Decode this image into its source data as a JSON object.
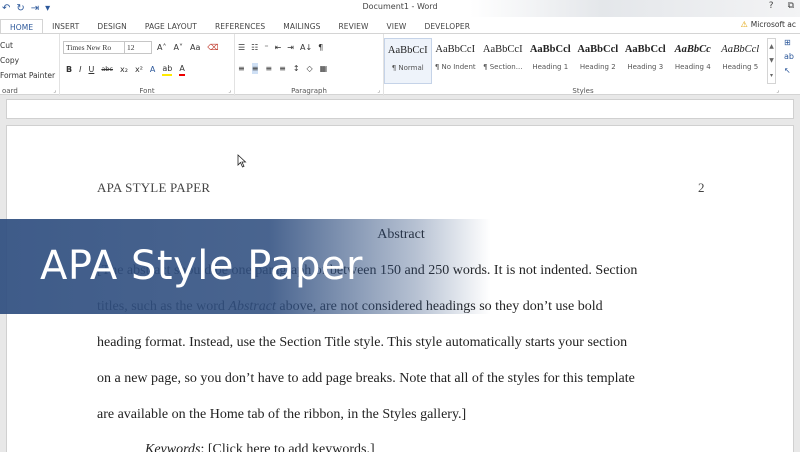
{
  "window": {
    "title": "Document1 - Word",
    "controls": [
      "?",
      "⧉"
    ]
  },
  "qat": {
    "undo": "↶",
    "redo": "↻",
    "touch": "⇥",
    "customize": "▾"
  },
  "tabs": [
    {
      "label": "HOME"
    },
    {
      "label": "INSERT"
    },
    {
      "label": "DESIGN"
    },
    {
      "label": "PAGE LAYOUT"
    },
    {
      "label": "REFERENCES"
    },
    {
      "label": "MAILINGS"
    },
    {
      "label": "REVIEW"
    },
    {
      "label": "VIEW"
    },
    {
      "label": "DEVELOPER"
    }
  ],
  "account": "Microsoft ac",
  "clipboard": {
    "items": [
      "Cut",
      "Copy",
      "Format Painter"
    ],
    "label": "oard"
  },
  "font": {
    "family": "Times New Ro",
    "size": "12",
    "grow": "A˄",
    "shrink": "A˅",
    "case": "Aa",
    "clear": "⌫",
    "bold": "B",
    "italic": "I",
    "underline": "U",
    "strike": "abc",
    "subscript": "x₂",
    "superscript": "x²",
    "effects": "A",
    "highlight": "ab",
    "color": "A",
    "label": "Font"
  },
  "paragraph": {
    "bullets": "☰",
    "numbering": "☷",
    "multilevel": "⁼",
    "decrease": "⇤",
    "increase": "⇥",
    "sort": "A↓",
    "pilcrow": "¶",
    "align_left": "≡",
    "center": "≡",
    "align_right": "≡",
    "justify": "≡",
    "spacing": "↕",
    "shading": "◇",
    "borders": "▦",
    "label": "Paragraph"
  },
  "styles": {
    "items": [
      {
        "preview": "AaBbCcI",
        "name": "¶ Normal"
      },
      {
        "preview": "AaBbCcI",
        "name": "¶ No Indent"
      },
      {
        "preview": "AaBbCcI",
        "name": "¶ Section..."
      },
      {
        "preview": "AaBbCcl",
        "name": "Heading 1"
      },
      {
        "preview": "AaBbCcl",
        "name": "Heading 2"
      },
      {
        "preview": "AaBbCcl",
        "name": "Heading 3"
      },
      {
        "preview": "AaBbCc",
        "name": "Heading 4"
      },
      {
        "preview": "AaBbCcl",
        "name": "Heading 5"
      }
    ],
    "label": "Styles"
  },
  "editing": {
    "find": "⊞",
    "replace": "ab",
    "select": "↖"
  },
  "document": {
    "running_head": "APA STYLE PAPER",
    "page_number": "2",
    "abstract_title": "Abstract",
    "lines": [
      "[The abstract should be one paragraph of between 150 and 250 words. It is not indented. Section",
      "titles, such as the word Abstract above, are not considered headings so they don’t use bold",
      "heading format. Instead, use the Section Title style. This style automatically starts your section",
      "on a new page, so you don’t have to add page breaks. Note that all of the styles for this template",
      "are available on the Home tab of the ribbon, in the Styles gallery.]"
    ],
    "keywords_label": "Keywords",
    "keywords_value": ": [Click here to add keywords.]"
  },
  "overlay": {
    "title": "APA Style Paper"
  },
  "colors": {
    "accent": "#2b579a",
    "banner": "#304f80"
  }
}
